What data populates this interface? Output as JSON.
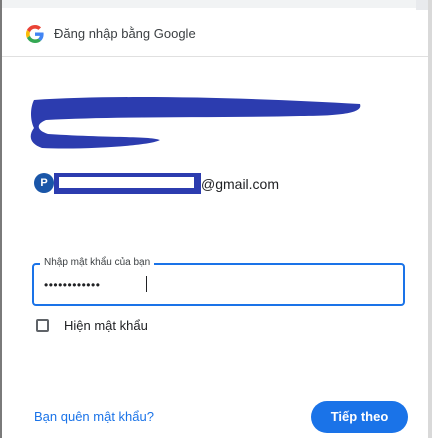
{
  "header": {
    "title": "Đăng nhập bằng Google",
    "logo_icon": "google-g-logo"
  },
  "account": {
    "avatar_initial": "P",
    "email_domain": "@gmail.com",
    "redaction_color": "#2c3caf"
  },
  "password": {
    "label": "Nhập mật khẩu của bạn",
    "masked_value": "••••••••••••"
  },
  "show_password": {
    "label": "Hiện mật khẩu",
    "checked": false
  },
  "footer": {
    "forgot_label": "Bạn quên mật khẩu?",
    "next_label": "Tiếp theo"
  },
  "colors": {
    "accent": "#1a73e8",
    "avatar": "#1a56a8",
    "text": "#202124"
  }
}
